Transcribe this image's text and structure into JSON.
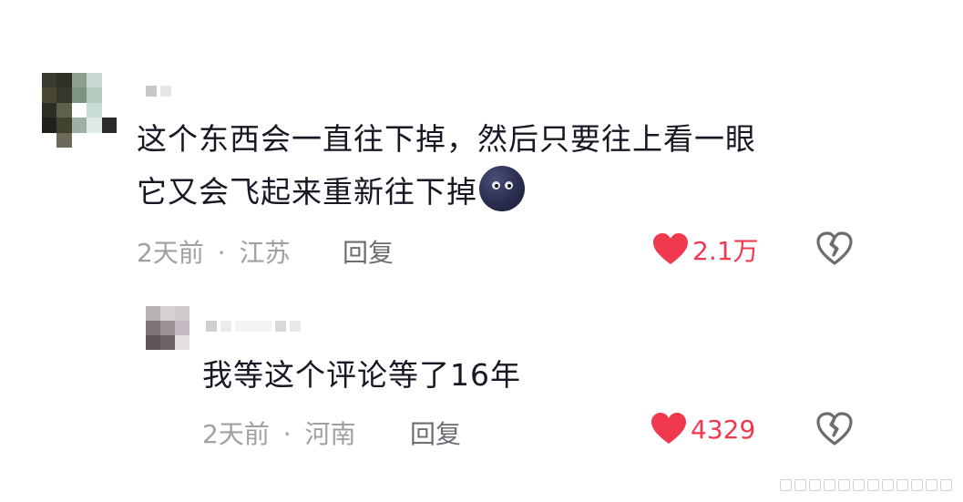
{
  "comments": [
    {
      "lines": [
        "这个东西会一直往下掉，然后只要往上看一眼",
        "它又会飞起来重新往下掉"
      ],
      "emoji": "new-moon-face",
      "time": "2天前",
      "separator": "·",
      "location": "江苏",
      "reply_label": "回复",
      "likes": "2.1万"
    },
    {
      "lines": [
        "我等这个评论等了16年"
      ],
      "time": "2天前",
      "separator": "·",
      "location": "河南",
      "reply_label": "回复",
      "likes": "4329"
    }
  ],
  "icons": {
    "like": "heart-icon",
    "dislike": "broken-heart-icon"
  },
  "colors": {
    "text": "#161823",
    "meta": "#9fa0a6",
    "like_red": "#f0384f"
  }
}
